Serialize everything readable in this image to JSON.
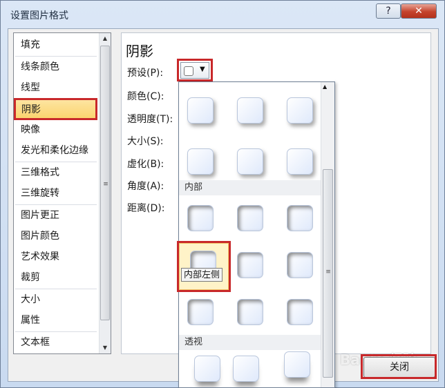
{
  "window": {
    "title": "设置图片格式",
    "help_label": "?",
    "close_label": "✕"
  },
  "sidebar": {
    "items": [
      {
        "label": "填充"
      },
      {
        "label": "线条颜色"
      },
      {
        "label": "线型"
      },
      {
        "label": "阴影"
      },
      {
        "label": "映像"
      },
      {
        "label": "发光和柔化边缘"
      },
      {
        "label": "三维格式"
      },
      {
        "label": "三维旋转"
      },
      {
        "label": "图片更正"
      },
      {
        "label": "图片颜色"
      },
      {
        "label": "艺术效果"
      },
      {
        "label": "裁剪"
      },
      {
        "label": "大小"
      },
      {
        "label": "属性"
      },
      {
        "label": "文本框"
      }
    ],
    "selected": "阴影"
  },
  "panel": {
    "heading": "阴影",
    "labels": {
      "preset": "预设(P):",
      "color": "颜色(C):",
      "transparency": "透明度(T):",
      "size": "大小(S):",
      "blur": "虚化(B):",
      "angle": "角度(A):",
      "distance": "距离(D):"
    }
  },
  "gallery": {
    "sections": [
      {
        "label": "内部"
      },
      {
        "label": "透视"
      }
    ],
    "tooltip": "内部左侧"
  },
  "footer": {
    "close_label": "关闭"
  },
  "watermark": "Baidu 经验",
  "colors": {
    "selected_bg": "#fbd46e",
    "highlight_border": "#c8282a"
  }
}
